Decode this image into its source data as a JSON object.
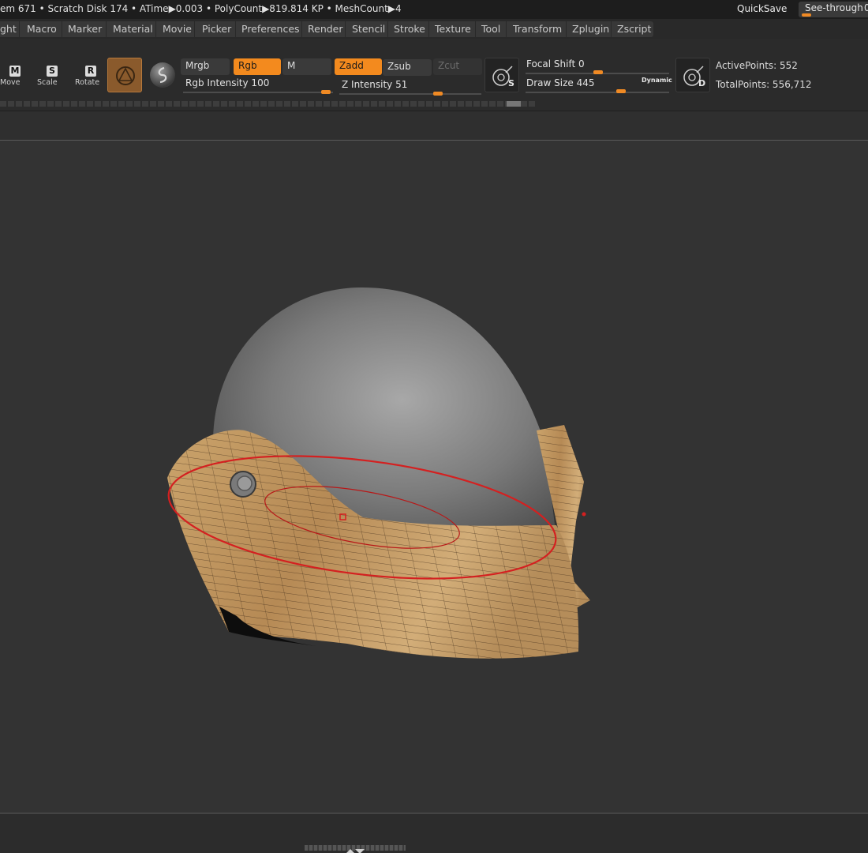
{
  "status": {
    "text": "em 671 • Scratch Disk 174 •  ATime▶0.003 • PolyCount▶819.814 KP  • MeshCount▶4",
    "quicksave": "QuickSave",
    "seethrough_label": "See-through",
    "seethrough_value": "0"
  },
  "menus": [
    "ght",
    "Macro",
    "Marker",
    "Material",
    "Movie",
    "Picker",
    "Preferences",
    "Render",
    "Stencil",
    "Stroke",
    "Texture",
    "Tool",
    "Transform",
    "Zplugin",
    "Zscript"
  ],
  "tools": {
    "move": {
      "letter": "M",
      "label": "Move"
    },
    "scale": {
      "letter": "S",
      "label": "Scale"
    },
    "rotate": {
      "letter": "R",
      "label": "Rotate"
    }
  },
  "buttons": {
    "mrgb": "Mrgb",
    "rgb": "Rgb",
    "m": "M",
    "zadd": "Zadd",
    "zsub": "Zsub",
    "zcut": "Zcut"
  },
  "sliders": {
    "rgb_intensity": {
      "label": "Rgb Intensity 100",
      "value": 100
    },
    "z_intensity": {
      "label": "Z Intensity 51",
      "value": 51
    },
    "focal_shift": {
      "label": "Focal Shift 0",
      "value": 0
    },
    "draw_size": {
      "label": "Draw Size 445",
      "value": 445
    }
  },
  "dynamic_label": "Dynamic",
  "stats": {
    "active_points": "ActivePoints: 552",
    "total_points": "TotalPoints: 556,712"
  },
  "colors": {
    "accent": "#f38a1e",
    "background": "#333333",
    "brush_ring": "#d42020",
    "mesh_tan": "#c9a46e",
    "mesh_gray": "#8c8c8c"
  }
}
